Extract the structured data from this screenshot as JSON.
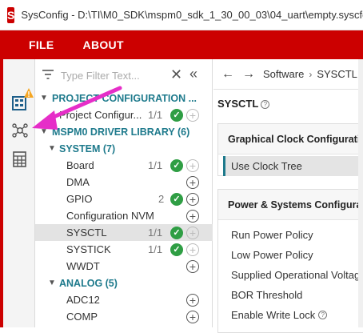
{
  "window": {
    "logo_text": "S",
    "title": "SysConfig - D:\\TI\\M0_SDK\\mspm0_sdk_1_30_00_03\\04_uart\\empty.syscfg*"
  },
  "menu": {
    "file": "FILE",
    "about": "ABOUT"
  },
  "colors": {
    "brand_red": "#cc0000",
    "category_teal": "#1e7a8c",
    "check_green": "#2f9e44",
    "annotation_magenta": "#e62ec8",
    "warning_orange": "#f5a623"
  },
  "sidebar_icons": [
    "overview-icon",
    "software-modules-icon",
    "board-view-icon"
  ],
  "filter": {
    "placeholder": "Type Filter Text...",
    "filter_icon": "filter-icon",
    "clear_icon": "close-icon",
    "collapse_icon": "double-chevron-left-icon"
  },
  "tree": {
    "project_config": {
      "label": "PROJECT CONFIGURATION ...",
      "child": {
        "label": "Project Configur...",
        "count": "1/1"
      }
    },
    "driver_library": {
      "label": "MSPM0 DRIVER LIBRARY (6)",
      "system": {
        "label": "SYSTEM (7)",
        "items": [
          {
            "label": "Board",
            "count": "1/1"
          },
          {
            "label": "DMA",
            "count": ""
          },
          {
            "label": "GPIO",
            "count": "2"
          },
          {
            "label": "Configuration NVM",
            "count": ""
          },
          {
            "label": "SYSCTL",
            "count": "1/1"
          },
          {
            "label": "SYSTICK",
            "count": "1/1"
          },
          {
            "label": "WWDT",
            "count": ""
          }
        ]
      },
      "analog": {
        "label": "ANALOG (5)",
        "items": [
          {
            "label": "ADC12",
            "count": ""
          },
          {
            "label": "COMP",
            "count": ""
          }
        ]
      }
    }
  },
  "breadcrumb": {
    "back_icon": "arrow-left-icon",
    "forward_icon": "arrow-right-icon",
    "root": "Software",
    "separator": "›",
    "current": "SYSCTL"
  },
  "module": {
    "title": "SYSCTL",
    "help": "?"
  },
  "clock_card": {
    "title": "Graphical Clock Configuration",
    "use_clock_tree": "Use Clock Tree"
  },
  "power_card": {
    "title": "Power & Systems Configuration",
    "rows": [
      "Run Power Policy",
      "Low Power Policy",
      "Supplied Operational Voltage",
      "BOR Threshold",
      "Enable Write Lock"
    ]
  }
}
